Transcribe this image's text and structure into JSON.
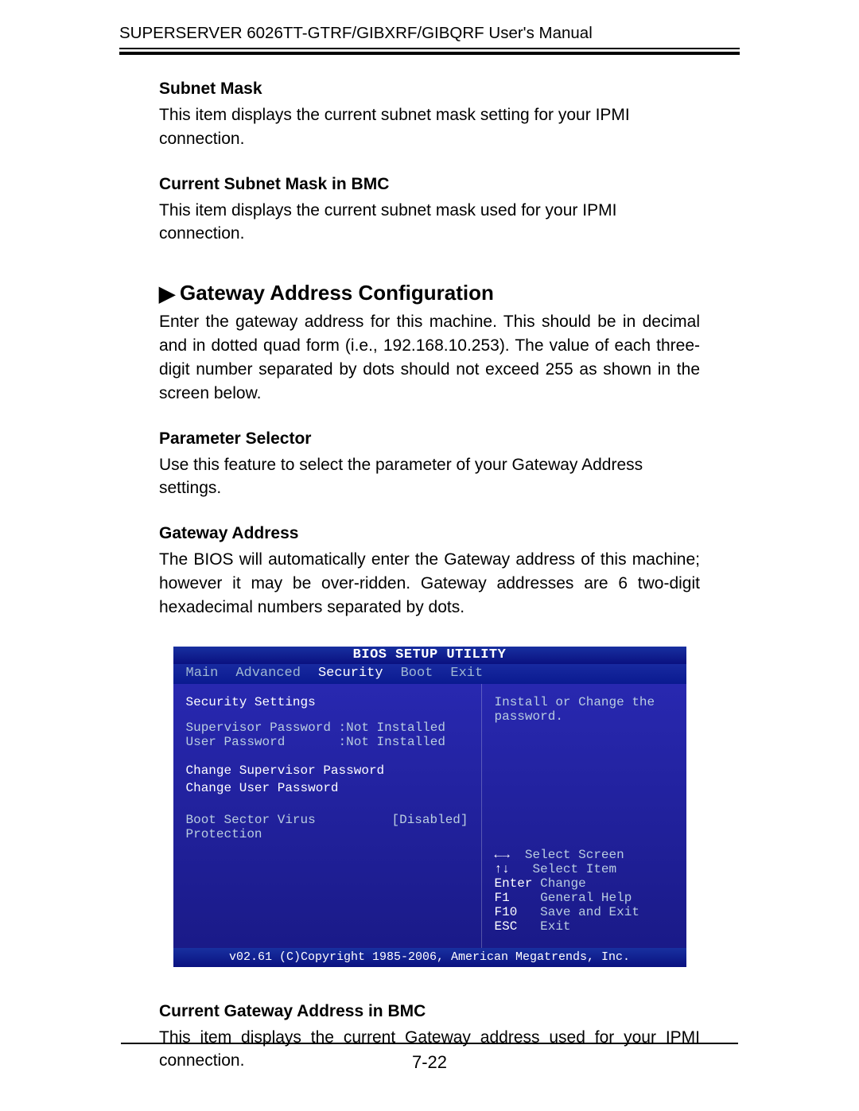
{
  "header": {
    "title": "SUPERSERVER 6026TT-GTRF/GIBXRF/GIBQRF User's Manual"
  },
  "sections": {
    "subnet_mask": {
      "title": "Subnet Mask",
      "body": "This item displays the current subnet mask setting for your IPMI connection."
    },
    "current_subnet_mask_bmc": {
      "title": "Current Subnet Mask in BMC",
      "body": "This item displays the current subnet mask used for your IPMI connection."
    },
    "gateway_config": {
      "title": "Gateway Address Configuration",
      "body": "Enter the gateway address for this machine. This should be in decimal and in dotted quad form (i.e., 192.168.10.253). The value of each three-digit number separated by dots should not exceed 255 as shown in the screen below."
    },
    "parameter_selector": {
      "title": "Parameter Selector",
      "body": "Use this feature to select the parameter of your Gateway Address settings."
    },
    "gateway_address": {
      "title": "Gateway Address",
      "body": "The BIOS will automatically enter the Gateway address of this machine; however it may be over-ridden. Gateway addresses are 6 two-digit hexadecimal numbers separated by dots."
    },
    "current_gateway_address_bmc": {
      "title": "Current Gateway Address in BMC",
      "body": "This item displays the current Gateway address used for your IPMI connection."
    }
  },
  "bios": {
    "title": "BIOS SETUP UTILITY",
    "tabs": {
      "main": "Main",
      "advanced": "Advanced",
      "security": "Security",
      "boot": "Boot",
      "exit": "Exit"
    },
    "heading": "Security Settings",
    "supervisor_pw_label": "Supervisor Password :Not Installed",
    "user_pw_label": "User Password       :Not Installed",
    "link_change_supervisor": "Change Supervisor Password",
    "link_change_user": "Change User Password",
    "boot_sector_label": "Boot Sector Virus Protection",
    "boot_sector_value": "[Disabled]",
    "help_text_1": "Install or Change the",
    "help_text_2": "password.",
    "keys": {
      "k1": "←→",
      "v1": "  Select Screen",
      "k2": "↑↓",
      "v2": "   Select Item",
      "k3": "Enter",
      "v3": " Change",
      "k4": "F1",
      "v4": "    General Help",
      "k5": "F10",
      "v5": "   Save and Exit",
      "k6": "ESC",
      "v6": "   Exit"
    },
    "footer": "v02.61 (C)Copyright 1985-2006, American Megatrends, Inc."
  },
  "page_number": "7-22"
}
